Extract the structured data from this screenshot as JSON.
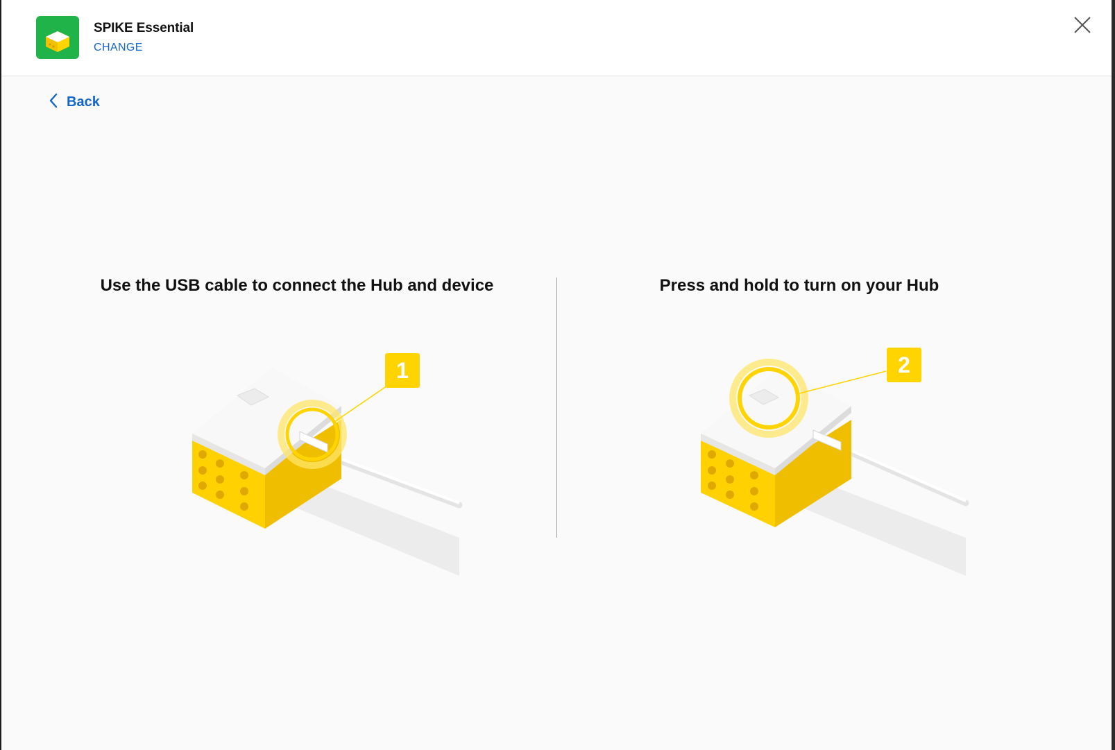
{
  "header": {
    "app_name": "SPIKE Essential",
    "change_label": "CHANGE",
    "app_icon": "spike-essential-hub-icon",
    "close_icon": "close-icon"
  },
  "navigation": {
    "back_label": "Back",
    "back_icon": "chevron-left-icon"
  },
  "steps": [
    {
      "title": "Use the USB cable to connect the Hub and device",
      "badge": "1"
    },
    {
      "title": "Press and hold to turn on your Hub",
      "badge": "2"
    }
  ],
  "colors": {
    "accent_blue": "#1366c9",
    "hub_yellow": "#ffd400",
    "app_green": "#1fb34a"
  }
}
